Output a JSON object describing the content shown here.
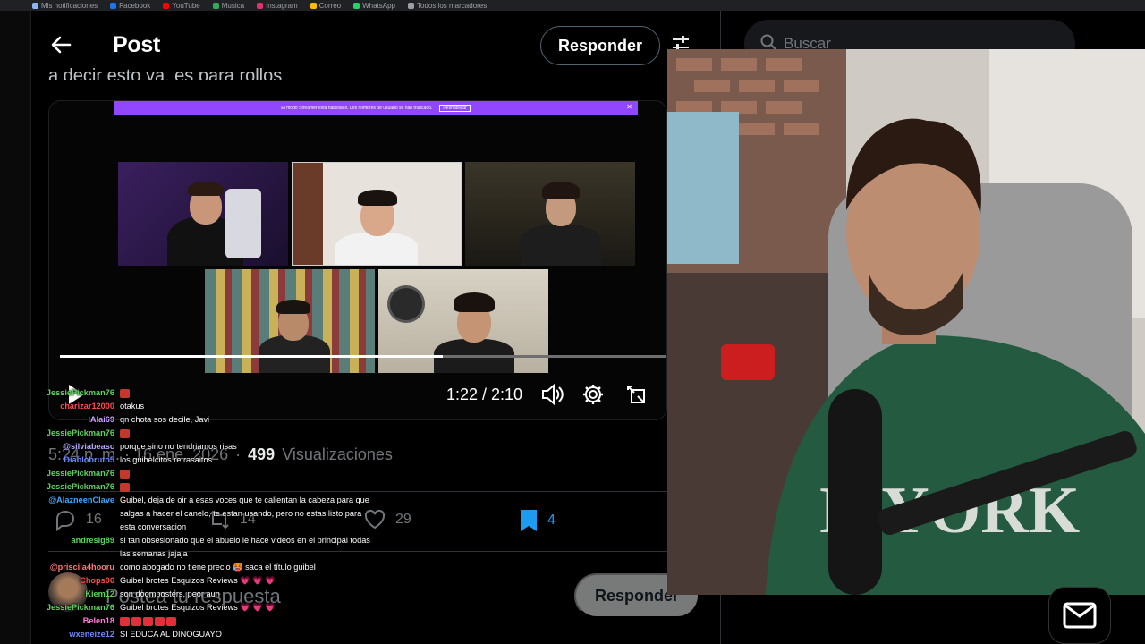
{
  "header": {
    "title": "Post",
    "reply_label": "Responder",
    "search_placeholder": "Buscar",
    "cut_text": "a decir esto ya, es para rollos"
  },
  "video": {
    "stream_notice": "El modo Streamer está habilitado. Los nombres de usuario se han truncado.",
    "stream_notice_button": "Deshabilitar",
    "time": "1:22 / 2:10",
    "progress": 0.63
  },
  "stats": {
    "timestamp": "5:24 p. m. · 16 ene. 2026",
    "views_count": "499",
    "views_label": "Visualizaciones",
    "replies": "16",
    "retweets": "14",
    "likes": "29",
    "bookmarks": "4"
  },
  "compose": {
    "placeholder": "Postea tu respuesta",
    "reply_label": "Responder"
  },
  "chat": [
    {
      "user": "JessiePickman76",
      "color": "#5fd35f",
      "msg": "",
      "emote": true
    },
    {
      "user": "charizar12000",
      "color": "#ff4d4d",
      "msg": "otakus"
    },
    {
      "user": "lAlai69",
      "color": "#c9a0ff",
      "msg": "qn chota sos decile, Javi"
    },
    {
      "user": "JessiePickman76",
      "color": "#5fd35f",
      "msg": "",
      "emote": true
    },
    {
      "user": "@silviabeasc",
      "color": "#b7a6ff",
      "msg": "porque sino no tendriamos risas"
    },
    {
      "user": "Diablobruto5",
      "color": "#6a8cff",
      "msg": "los guibelcitos retrasaitos"
    },
    {
      "user": "JessiePickman76",
      "color": "#5fd35f",
      "msg": "",
      "emote": true
    },
    {
      "user": "JessiePickman76",
      "color": "#5fd35f",
      "msg": "",
      "emote": true
    },
    {
      "user": "@AlazneenClave",
      "color": "#3fa9ff",
      "msg": "Guibel, deja de oir a esas voces que te calientan la cabeza para que salgas a hacer el canelo, te estan usando, pero no estas listo para esta conversacion"
    },
    {
      "user": "andresig89",
      "color": "#5fd35f",
      "msg": "si tan obsesionado que el abuelo le hace videos en el principal todas las semanas jajaja"
    },
    {
      "user": "@priscila4hooru",
      "color": "#ff7a7a",
      "msg": "como abogado no tiene precio 🥵 saca el título guibel"
    },
    {
      "user": "Chops06",
      "color": "#ff4d4d",
      "msg": "Guibel brotes Esquizos Reviews 💗 💗 💗"
    },
    {
      "user": "Kiem12",
      "color": "#5fd35f",
      "msg": "son doomposters, peor aun"
    },
    {
      "user": "JessiePickman76",
      "color": "#5fd35f",
      "msg": "Guibel brotes Esquizos Reviews 💗 💗 💗"
    },
    {
      "user": "Belen18",
      "color": "#ff7ad9",
      "msg": "",
      "emote_row": true
    },
    {
      "user": "wxeneize12",
      "color": "#6a8cff",
      "msg": "SI EDUCA AL DINOGUAYO"
    }
  ],
  "bookmarks": [
    {
      "label": "Mis notificaciones",
      "color": "#8ab4f8"
    },
    {
      "label": "Facebook",
      "color": "#1877f2"
    },
    {
      "label": "YouTube",
      "color": "#ff0000"
    },
    {
      "label": "Musica",
      "color": "#34a853"
    },
    {
      "label": "Instagram",
      "color": "#e1306c"
    },
    {
      "label": "Correo",
      "color": "#fbbc04"
    },
    {
      "label": "WhatsApp",
      "color": "#25d366"
    },
    {
      "label": "Todos los marcadores",
      "color": "#9aa0a6"
    }
  ],
  "colors": {
    "accent": "#1d9bf0",
    "twitch": "#9146ff"
  }
}
